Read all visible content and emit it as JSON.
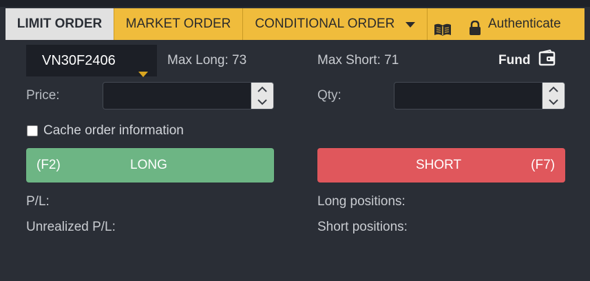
{
  "tabs": {
    "limit": "LIMIT ORDER",
    "market": "MARKET ORDER",
    "conditional": "CONDITIONAL ORDER",
    "authenticate": "Authenticate"
  },
  "order": {
    "symbol": "VN30F2406",
    "max_long": "Max Long: 73",
    "max_short": "Max Short: 71",
    "fund_label": "Fund",
    "price_label": "Price:",
    "qty_label": "Qty:",
    "price_value": "",
    "qty_value": "",
    "cache_label": "Cache order information",
    "cache_checked": false
  },
  "buttons": {
    "long_key": "(F2)",
    "long_label": "LONG",
    "short_label": "SHORT",
    "short_key": "(F7)"
  },
  "summary": {
    "pl_label": "P/L:",
    "unrealized_label": "Unrealized P/L:",
    "long_positions_label": "Long positions:",
    "short_positions_label": "Short positions:"
  },
  "colors": {
    "tab_accent": "#f0bc3c",
    "long": "#6db584",
    "short": "#e0575c",
    "background": "#2a2e36"
  },
  "icons": [
    "chevron-down-icon",
    "book-icon",
    "lock-icon",
    "wallet-icon",
    "spinner-up-icon",
    "spinner-down-icon"
  ]
}
